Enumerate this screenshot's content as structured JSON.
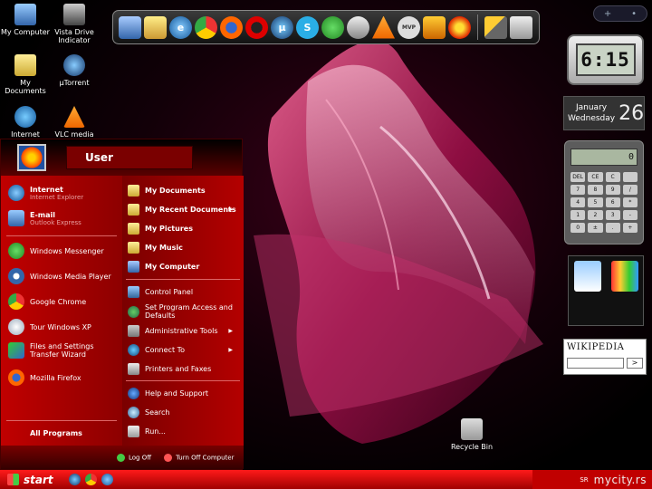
{
  "desktop_icons": [
    {
      "label": "My Computer"
    },
    {
      "label": "Vista Drive Indicator"
    },
    {
      "label": "My Documents"
    },
    {
      "label": "µTorrent"
    },
    {
      "label": "Internet"
    },
    {
      "label": "VLC media"
    }
  ],
  "dock": {
    "icons": [
      "computer-icon",
      "mail-icon",
      "internet-explorer-icon",
      "chrome-icon",
      "firefox-icon",
      "opera-icon",
      "utorrent-icon",
      "skype-icon",
      "messenger-icon",
      "nero-icon",
      "vlc-icon",
      "mvp-icon",
      "winamp-icon",
      "burn-icon",
      "tools-icon",
      "recycle-bin-icon"
    ],
    "mvp_label": "MVP",
    "mu_label": "µ",
    "skype_label": "S"
  },
  "sidebar": {
    "top_buttons": [
      "+",
      "•"
    ],
    "clock": {
      "time": "6:15"
    },
    "calendar": {
      "month": "January",
      "weekday": "Wednesday",
      "day": "26"
    },
    "calculator": {
      "display": "0",
      "keys": [
        "DEL",
        "CE",
        "C",
        "",
        "7",
        "8",
        "9",
        "/",
        "4",
        "5",
        "6",
        "*",
        "1",
        "2",
        "3",
        "-",
        "0",
        "±",
        ".",
        "+"
      ]
    },
    "wikipedia": {
      "title": "WIKIPEDIA",
      "go": ">"
    }
  },
  "recycle_bin": {
    "label": "Recycle Bin"
  },
  "start_menu": {
    "user": "User",
    "left_pinned": [
      {
        "label": "Internet",
        "sub": "Internet Explorer"
      },
      {
        "label": "E-mail",
        "sub": "Outlook Express"
      }
    ],
    "left_recent": [
      {
        "label": "Windows Messenger"
      },
      {
        "label": "Windows Media Player"
      },
      {
        "label": "Google Chrome"
      },
      {
        "label": "Tour Windows XP"
      },
      {
        "label": "Files and Settings Transfer Wizard"
      },
      {
        "label": "Mozilla Firefox"
      }
    ],
    "all_programs": "All Programs",
    "right_places": [
      {
        "label": "My Documents"
      },
      {
        "label": "My Recent Documents"
      },
      {
        "label": "My Pictures"
      },
      {
        "label": "My Music"
      },
      {
        "label": "My Computer"
      }
    ],
    "right_system": [
      {
        "label": "Control Panel"
      },
      {
        "label": "Set Program Access and Defaults"
      },
      {
        "label": "Administrative Tools"
      },
      {
        "label": "Connect To"
      },
      {
        "label": "Printers and Faxes"
      }
    ],
    "right_help": [
      {
        "label": "Help and Support"
      },
      {
        "label": "Search"
      },
      {
        "label": "Run..."
      }
    ],
    "log_off": "Log Off",
    "turn_off": "Turn Off Computer"
  },
  "taskbar": {
    "start": "start",
    "lang": "SR",
    "watermark": "mycity.rs"
  }
}
